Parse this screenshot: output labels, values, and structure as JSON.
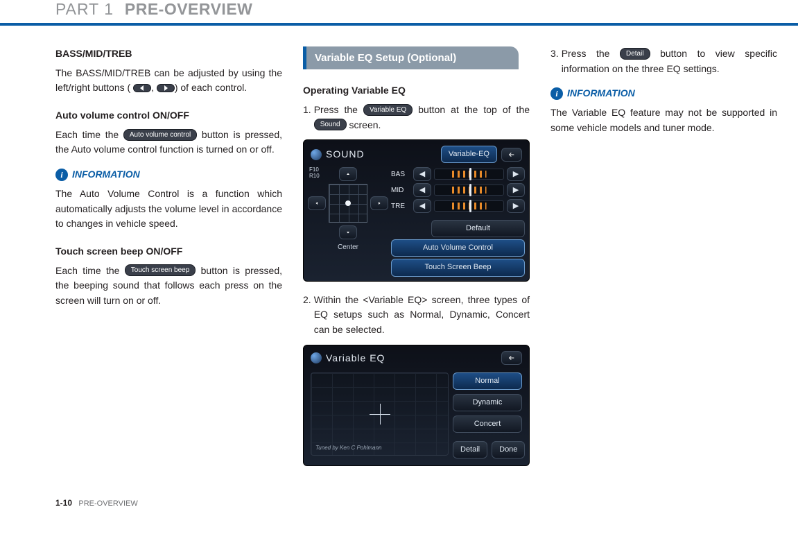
{
  "header": {
    "part": "PART 1",
    "title": "PRE-OVERVIEW"
  },
  "col1": {
    "h_bass": "BASS/MID/TREB",
    "p_bass_a": "The BASS/MID/TREB can be adjusted by using the left/right buttons (",
    "p_bass_b": ", ",
    "p_bass_c": ") of each control.",
    "h_avc": "Auto volume control ON/OFF",
    "p_avc_a": "Each time the ",
    "p_avc_b": " button is pressed, the Auto volume control function is turned on or off.",
    "btn_avc": "Auto volume control",
    "info": "INFORMATION",
    "p_info": "The Auto Volume Control is a function which automatically adjusts the volume level in accordance to changes in vehicle speed.",
    "h_beep": "Touch screen beep ON/OFF",
    "p_beep_a": "Each time the ",
    "p_beep_b": " button is pressed, the beeping sound that follows each press on the screen will turn on or off.",
    "btn_beep": "Touch screen beep"
  },
  "col2": {
    "tab": "Variable EQ Setup (Optional)",
    "h_op": "Operating Variable EQ",
    "s1_a": "Press the ",
    "s1_b": " button at the top of the ",
    "s1_c": " screen.",
    "btn_veq": "Variable EQ",
    "btn_sound": "Sound",
    "s2": "Within the <Variable EQ> screen, three types of EQ setups such as Normal, Dynamic, Concert can be selected.",
    "panel1": {
      "title": "SOUND",
      "topbtn": "Variable-EQ",
      "f10": "F10",
      "r10": "R10",
      "bas": "BAS",
      "mid": "MID",
      "tre": "TRE",
      "center": "Center",
      "default": "Default",
      "avc": "Auto Volume Control",
      "beep": "Touch Screen Beep"
    },
    "panel2": {
      "title": "Variable EQ",
      "normal": "Normal",
      "dynamic": "Dynamic",
      "concert": "Concert",
      "detail": "Detail",
      "done": "Done",
      "tuned": "Tuned by Ken C Pohlmann"
    }
  },
  "col3": {
    "s3_a": "Press the ",
    "s3_b": " button to view specific information on the three EQ settings.",
    "btn_detail": "Detail",
    "info": "INFORMATION",
    "p_info": "The Variable EQ feature may not be supported in some vehicle models and tuner mode."
  },
  "footer": {
    "page": "1-10",
    "section": "PRE-OVERVIEW"
  }
}
